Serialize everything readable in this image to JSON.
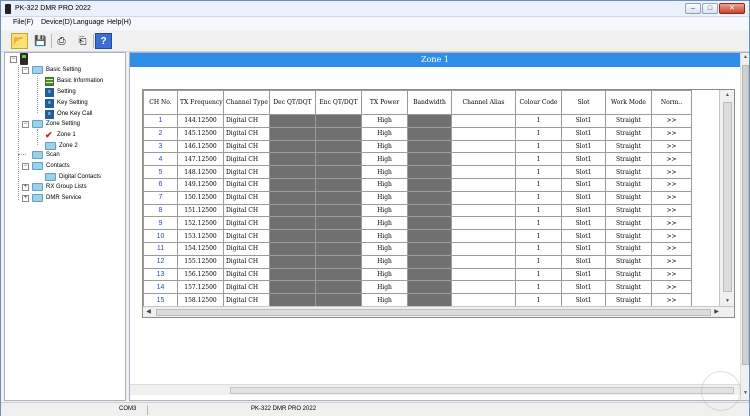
{
  "window": {
    "title": "PK-322 DMR PRO 2022"
  },
  "menu": [
    "File(F)",
    "Device(D)",
    "Language",
    "Help(H)"
  ],
  "toolbar": {
    "open": "open-folder-icon",
    "save": "save-icon",
    "read": "read-from-radio-icon",
    "write": "write-to-radio-icon",
    "help": "?"
  },
  "tree": {
    "basic_setting": "Basic Setting",
    "basic_information": "Basic Information",
    "setting": "Setting",
    "key_setting": "Key Setting",
    "one_key_call": "One Key Call",
    "zone_setting": "Zone Setting",
    "zone1": "Zone 1",
    "zone2": "Zone 2",
    "scan": "Scan",
    "contacts": "Contacts",
    "digital_contacts": "Digital Contacts",
    "rx_group_lists": "RX Group Lists",
    "dmr_service": "DMR Service"
  },
  "zone": {
    "title": "Zone 1"
  },
  "table": {
    "columns": [
      "CH No.",
      "TX Frequency",
      "Channel Type",
      "Dec QT/DQT",
      "Enc QT/DQT",
      "TX Power",
      "Bandwidth",
      "Channel Alias",
      "Colour Code",
      "Slot",
      "Work Mode",
      "Norm.."
    ],
    "rows": [
      [
        "1",
        "144.12500",
        "Digital CH",
        "",
        "",
        "High",
        "",
        "",
        "1",
        "Slot1",
        "Straight",
        ">>"
      ],
      [
        "2",
        "145.12500",
        "Digital CH",
        "",
        "",
        "High",
        "",
        "",
        "1",
        "Slot1",
        "Straight",
        ">>"
      ],
      [
        "3",
        "146.12500",
        "Digital CH",
        "",
        "",
        "High",
        "",
        "",
        "1",
        "Slot1",
        "Straight",
        ">>"
      ],
      [
        "4",
        "147.12500",
        "Digital CH",
        "",
        "",
        "High",
        "",
        "",
        "1",
        "Slot1",
        "Straight",
        ">>"
      ],
      [
        "5",
        "148.12500",
        "Digital CH",
        "",
        "",
        "High",
        "",
        "",
        "1",
        "Slot1",
        "Straight",
        ">>"
      ],
      [
        "6",
        "149.12500",
        "Digital CH",
        "",
        "",
        "High",
        "",
        "",
        "1",
        "Slot1",
        "Straight",
        ">>"
      ],
      [
        "7",
        "150.12500",
        "Digital CH",
        "",
        "",
        "High",
        "",
        "",
        "1",
        "Slot1",
        "Straight",
        ">>"
      ],
      [
        "8",
        "151.12500",
        "Digital CH",
        "",
        "",
        "High",
        "",
        "",
        "1",
        "Slot1",
        "Straight",
        ">>"
      ],
      [
        "9",
        "152.12500",
        "Digital CH",
        "",
        "",
        "High",
        "",
        "",
        "1",
        "Slot1",
        "Straight",
        ">>"
      ],
      [
        "10",
        "153.12500",
        "Digital CH",
        "",
        "",
        "High",
        "",
        "",
        "1",
        "Slot1",
        "Straight",
        ">>"
      ],
      [
        "11",
        "154.12500",
        "Digital CH",
        "",
        "",
        "High",
        "",
        "",
        "1",
        "Slot1",
        "Straight",
        ">>"
      ],
      [
        "12",
        "155.12500",
        "Digital CH",
        "",
        "",
        "High",
        "",
        "",
        "1",
        "Slot1",
        "Straight",
        ">>"
      ],
      [
        "13",
        "156.12500",
        "Digital CH",
        "",
        "",
        "High",
        "",
        "",
        "1",
        "Slot1",
        "Straight",
        ">>"
      ],
      [
        "14",
        "157.12500",
        "Digital CH",
        "",
        "",
        "High",
        "",
        "",
        "1",
        "Slot1",
        "Straight",
        ">>"
      ],
      [
        "15",
        "158.12500",
        "Digital CH",
        "",
        "",
        "High",
        "",
        "",
        "1",
        "Slot1",
        "Straight",
        ">>"
      ]
    ]
  },
  "status": {
    "model": "COM3",
    "app": "PK-322 DMR PRO 2022"
  },
  "colors": {
    "zone_header": "#2f8fe8",
    "locked_cell": "#707070",
    "channel_number": "#2a4bc4"
  }
}
